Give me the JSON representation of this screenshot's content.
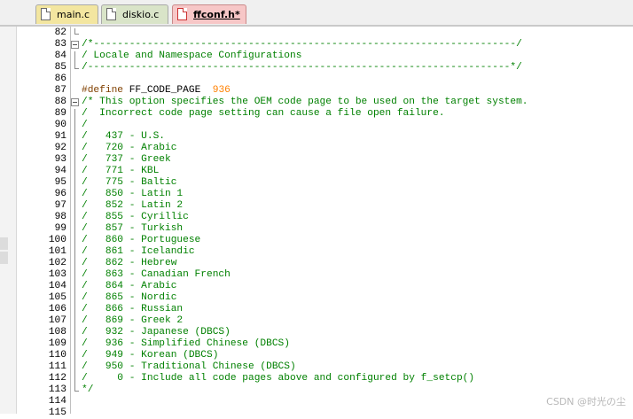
{
  "tabs": [
    {
      "label": "main.c",
      "active": false
    },
    {
      "label": "diskio.c",
      "active": false
    },
    {
      "label": "ffconf.h*",
      "active": true
    }
  ],
  "editor": {
    "lines": [
      {
        "num": "82",
        "text": "",
        "fold": "end"
      },
      {
        "num": "83",
        "text": "/*-----------------------------------------------------------------------/",
        "fold": "box"
      },
      {
        "num": "84",
        "text": "/ Locale and Namespace Configurations",
        "fold": "bar"
      },
      {
        "num": "85",
        "text": "/-----------------------------------------------------------------------*/",
        "fold": "end"
      },
      {
        "num": "86",
        "text": "",
        "fold": ""
      },
      {
        "num": "87",
        "text": "",
        "fold": "",
        "define_kw": "#define",
        "define_name": "FF_CODE_PAGE",
        "define_val": "936"
      },
      {
        "num": "88",
        "text": "/* This option specifies the OEM code page to be used on the target system.",
        "fold": "box"
      },
      {
        "num": "89",
        "text": "/  Incorrect code page setting can cause a file open failure.",
        "fold": "bar"
      },
      {
        "num": "90",
        "text": "/",
        "fold": "bar"
      },
      {
        "num": "91",
        "text": "/   437 - U.S.",
        "fold": "bar"
      },
      {
        "num": "92",
        "text": "/   720 - Arabic",
        "fold": "bar"
      },
      {
        "num": "93",
        "text": "/   737 - Greek",
        "fold": "bar"
      },
      {
        "num": "94",
        "text": "/   771 - KBL",
        "fold": "bar"
      },
      {
        "num": "95",
        "text": "/   775 - Baltic",
        "fold": "bar"
      },
      {
        "num": "96",
        "text": "/   850 - Latin 1",
        "fold": "bar"
      },
      {
        "num": "97",
        "text": "/   852 - Latin 2",
        "fold": "bar"
      },
      {
        "num": "98",
        "text": "/   855 - Cyrillic",
        "fold": "bar"
      },
      {
        "num": "99",
        "text": "/   857 - Turkish",
        "fold": "bar"
      },
      {
        "num": "100",
        "text": "/   860 - Portuguese",
        "fold": "bar"
      },
      {
        "num": "101",
        "text": "/   861 - Icelandic",
        "fold": "bar"
      },
      {
        "num": "102",
        "text": "/   862 - Hebrew",
        "fold": "bar"
      },
      {
        "num": "103",
        "text": "/   863 - Canadian French",
        "fold": "bar"
      },
      {
        "num": "104",
        "text": "/   864 - Arabic",
        "fold": "bar"
      },
      {
        "num": "105",
        "text": "/   865 - Nordic",
        "fold": "bar"
      },
      {
        "num": "106",
        "text": "/   866 - Russian",
        "fold": "bar"
      },
      {
        "num": "107",
        "text": "/   869 - Greek 2",
        "fold": "bar"
      },
      {
        "num": "108",
        "text": "/   932 - Japanese (DBCS)",
        "fold": "bar"
      },
      {
        "num": "109",
        "text": "/   936 - Simplified Chinese (DBCS)",
        "fold": "bar"
      },
      {
        "num": "110",
        "text": "/   949 - Korean (DBCS)",
        "fold": "bar"
      },
      {
        "num": "111",
        "text": "/   950 - Traditional Chinese (DBCS)",
        "fold": "bar"
      },
      {
        "num": "112",
        "text": "/     0 - Include all code pages above and configured by f_setcp()",
        "fold": "bar"
      },
      {
        "num": "113",
        "text": "*/",
        "fold": "end"
      },
      {
        "num": "114",
        "text": "",
        "fold": ""
      },
      {
        "num": "115",
        "text": "",
        "fold": ""
      }
    ]
  },
  "watermark": "CSDN @时光の尘",
  "colors": {
    "comment": "#008000",
    "preprocessor": "#804000",
    "number": "#ff8000",
    "active_tab": "#f7c7c7"
  }
}
